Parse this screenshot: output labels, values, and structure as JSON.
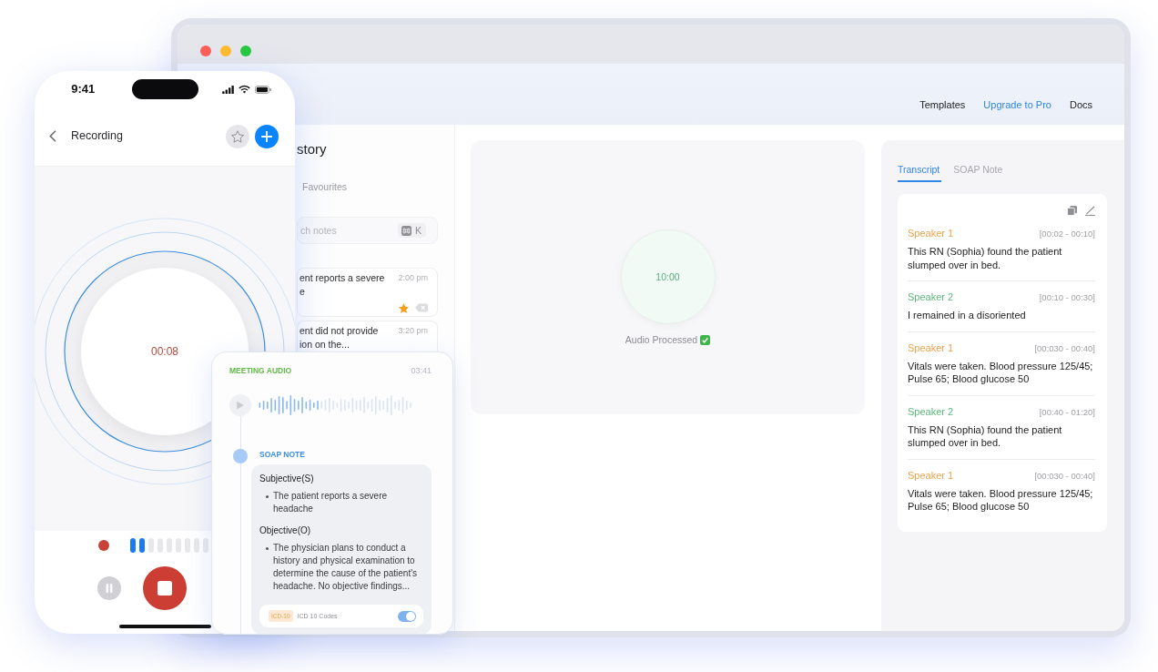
{
  "window": {
    "nav_links": [
      {
        "label": "Templates",
        "kind": "plain"
      },
      {
        "label": "Upgrade to Pro",
        "kind": "accent"
      },
      {
        "label": "Docs",
        "kind": "plain"
      }
    ]
  },
  "history": {
    "title": "story",
    "tabs": [
      {
        "label": "Favourites",
        "selected": false
      }
    ],
    "search": {
      "placeholder": "ch notes",
      "shortcut": "K"
    },
    "notes": [
      {
        "text": "ent reports a severe\ne",
        "time": "2:00 pm",
        "starred": true
      }
    ],
    "last_note": {
      "text": "ent did not provide\nion on the...",
      "time": "3:20 pm"
    }
  },
  "processing": {
    "timer": "10:00",
    "status": "Audio Processed"
  },
  "transcript": {
    "tabs": [
      {
        "label": "Transcript",
        "selected": true
      },
      {
        "label": "SOAP Note",
        "selected": false
      }
    ],
    "entries": [
      {
        "speaker": "Speaker 1",
        "color": "#f0a04b",
        "time": "[00:02 - 00:10]",
        "text": "This RN (Sophia) found the patient slumped over in bed."
      },
      {
        "speaker": "Speaker 2",
        "color": "#5cb87a",
        "time": "[00:10 - 00:30]",
        "text": "I remained in a disoriented"
      },
      {
        "speaker": "Speaker 1",
        "color": "#f0a04b",
        "time": "[00:030 - 00:40]",
        "text": "Vitals were taken. Blood pressure 125/45; Pulse 65; Blood glucose 50"
      },
      {
        "speaker": "Speaker 2",
        "color": "#5cb87a",
        "time": "[00:40 - 01:20]",
        "text": "This RN (Sophia) found the patient slumped over in bed."
      },
      {
        "speaker": "Speaker 1",
        "color": "#f0a04b",
        "time": "[00:030 - 00:40]",
        "text": "Vitals were taken. Blood pressure 125/45; Pulse 65; Blood glucose 50"
      }
    ]
  },
  "phone": {
    "time": "9:41",
    "title": "Recording",
    "timer": "00:08",
    "level": 0.22
  },
  "audio_card": {
    "label": "MEETING AUDIO",
    "duration": "03:41",
    "soap": {
      "label": "SOAP NOTE",
      "sections": [
        {
          "heading": "Subjective(S)",
          "bullets": [
            "The patient reports a severe headache"
          ]
        },
        {
          "heading": "Objective(O)",
          "bullets": [
            "The physician plans to conduct a history and physical examination to determine the cause of the patient's headache. No objective findings..."
          ]
        }
      ],
      "codes": {
        "tag": "ICD-10",
        "label": "ICD 10 Codes",
        "on": true
      }
    }
  }
}
